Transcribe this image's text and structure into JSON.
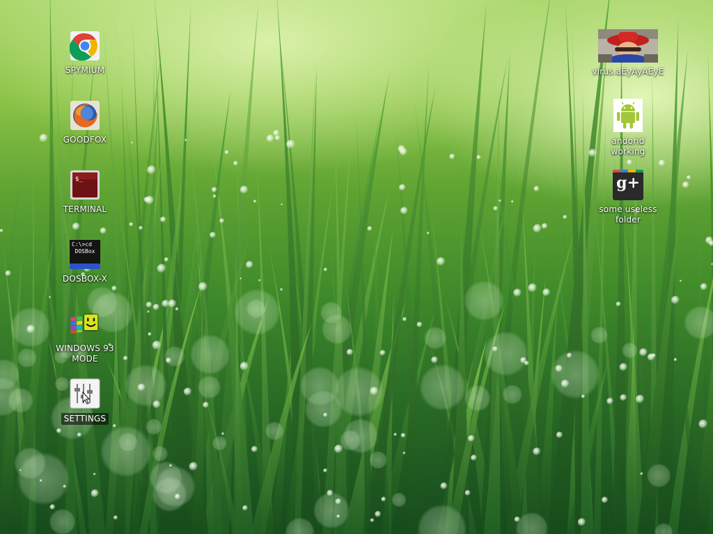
{
  "desktop": {
    "left_icons": [
      {
        "label": "SPYMIUM",
        "icon": "chrome-icon"
      },
      {
        "label": "GOODFOX",
        "icon": "firefox-icon"
      },
      {
        "label": "TERMINAL",
        "icon": "terminal-icon"
      },
      {
        "label": "DOSBOX-X",
        "icon": "dosbox-icon",
        "glyph_lines": [
          "C:\\>cd",
          "DOSBox"
        ]
      },
      {
        "label": "WINDOWS 93\nMODE",
        "icon": "windows93-icon"
      },
      {
        "label": "SETTINGS",
        "icon": "settings-icon"
      }
    ],
    "right_icons": [
      {
        "label": "virus.aEyAyAEyE",
        "icon": "mario-image-icon"
      },
      {
        "label": "andorid working",
        "icon": "android-icon"
      },
      {
        "label": "some useless\nfolder",
        "icon": "google-plus-icon",
        "glyph_text": "g+"
      }
    ]
  },
  "colors": {
    "terminal_red": "#7a1518",
    "android_green": "#a4c639",
    "gplus_red": "#dd4b39",
    "chrome_blue": "#4285f4"
  }
}
